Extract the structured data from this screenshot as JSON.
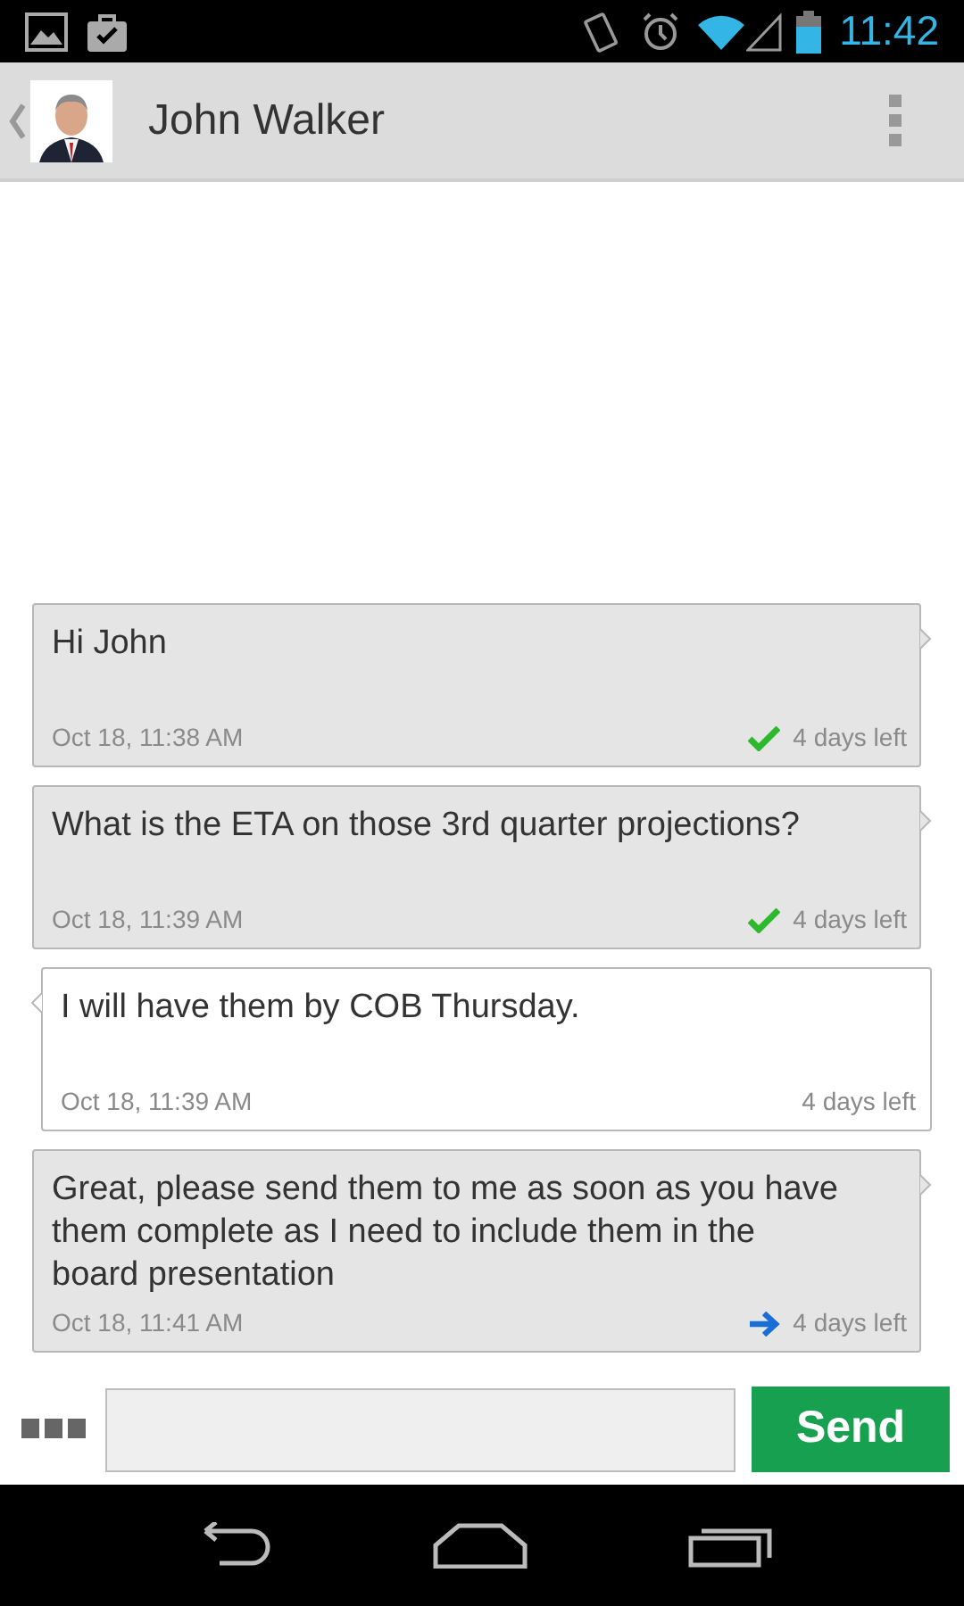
{
  "status_bar": {
    "time": "11:42"
  },
  "header": {
    "contact_name": "John Walker"
  },
  "messages": [
    {
      "kind": "sent",
      "text": "Hi John",
      "timestamp": "Oct 18, 11:38 AM",
      "status_icon": {
        "kind": "check"
      },
      "expiry": "4 days left"
    },
    {
      "kind": "sent",
      "text": "What is the ETA on those 3rd quarter projections?",
      "timestamp": "Oct 18, 11:39 AM",
      "status_icon": {
        "kind": "check"
      },
      "expiry": "4 days left"
    },
    {
      "kind": "received",
      "text": "I will have them by COB Thursday.",
      "timestamp": "Oct 18, 11:39 AM",
      "expiry": "4 days left"
    },
    {
      "kind": "sent",
      "text": "Great, please send them to me as soon as you have them complete as I need to include them in the board presentation",
      "timestamp": "Oct 18, 11:41 AM",
      "status_icon": {
        "kind": "arrow"
      },
      "expiry": "4 days left"
    }
  ],
  "composer": {
    "send_label": "Send"
  }
}
